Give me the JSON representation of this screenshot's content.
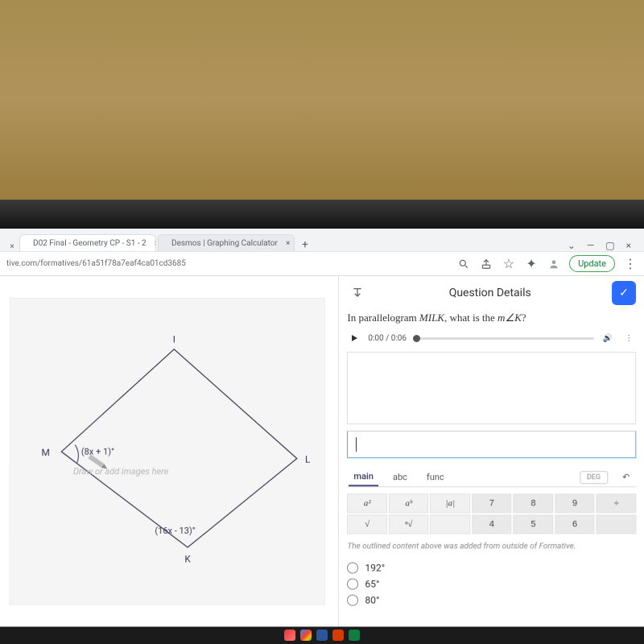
{
  "browser": {
    "tabs": [
      {
        "label": "D02 Final - Geometry CP - S1 - 2"
      },
      {
        "label": "Desmos | Graphing Calculator"
      }
    ],
    "url": "tive.com/formatives/61a51f78a7eaf4ca01cd3685",
    "update_label": "Update"
  },
  "figure": {
    "placeholder": "Draw or add images here",
    "vertices": {
      "top": "I",
      "right": "L",
      "bottom": "K",
      "left": "M"
    },
    "angle_M": "(8x + 1)°",
    "angle_K": "(16x - 13)°"
  },
  "details": {
    "header": "Question Details",
    "question_prefix": "In parallelogram ",
    "question_word": "MILK",
    "question_mid": ", what is the ",
    "question_angle": "m∠K",
    "question_suffix": "?",
    "audio_time": "0:00 / 0:06",
    "keypad_tabs": {
      "main": "main",
      "abc": "abc",
      "func": "func",
      "deg": "DEG"
    },
    "keys_row1": [
      "a²",
      "aᵇ",
      "|a|",
      "7",
      "8",
      "9",
      "÷"
    ],
    "keys_row2": [
      "√",
      "ⁿ√",
      "4",
      "5",
      "6"
    ],
    "hint": "The outlined content above was added from outside of Formative.",
    "choices": [
      "192°",
      "65°",
      "80°"
    ]
  }
}
